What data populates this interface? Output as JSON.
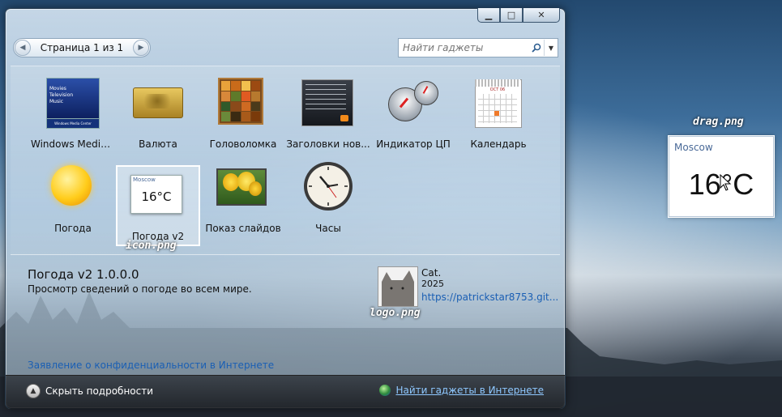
{
  "window": {
    "pager": {
      "text": "Страница 1 из 1"
    },
    "search": {
      "placeholder": "Найти гаджеты"
    },
    "gadgets": [
      {
        "label": "Windows Media..."
      },
      {
        "label": "Валюта"
      },
      {
        "label": "Головоломка"
      },
      {
        "label": "Заголовки нов..."
      },
      {
        "label": "Индикатор ЦП"
      },
      {
        "label": "Календарь"
      },
      {
        "label": "Погода"
      },
      {
        "label": "Погода v2"
      },
      {
        "label": "Показ слайдов"
      },
      {
        "label": "Часы"
      }
    ],
    "thumbs": {
      "wmc_lines": [
        "Movies",
        "Television",
        "Music"
      ],
      "wmc_bar": "Windows Media Center",
      "calendar_month": "OCT 06",
      "weather_v2_city": "Moscow",
      "weather_v2_temp": "16°C"
    },
    "details": {
      "title": "Погода v2 1.0.0.0",
      "description": "Просмотр сведений о погоде во всем мире.",
      "author": "Cat.",
      "year": "2025",
      "url": "https://patrickstar8753.git...",
      "privacy_link": "Заявление о конфиденциальности в Интернете"
    },
    "footer": {
      "hide_details": "Скрыть подробности",
      "find_online": "Найти гаджеты в Интернете"
    }
  },
  "captions": {
    "icon": "icon.png",
    "logo": "logo.png",
    "drag": "drag.png"
  },
  "drag_preview": {
    "city": "Moscow",
    "temp": "16°C"
  }
}
